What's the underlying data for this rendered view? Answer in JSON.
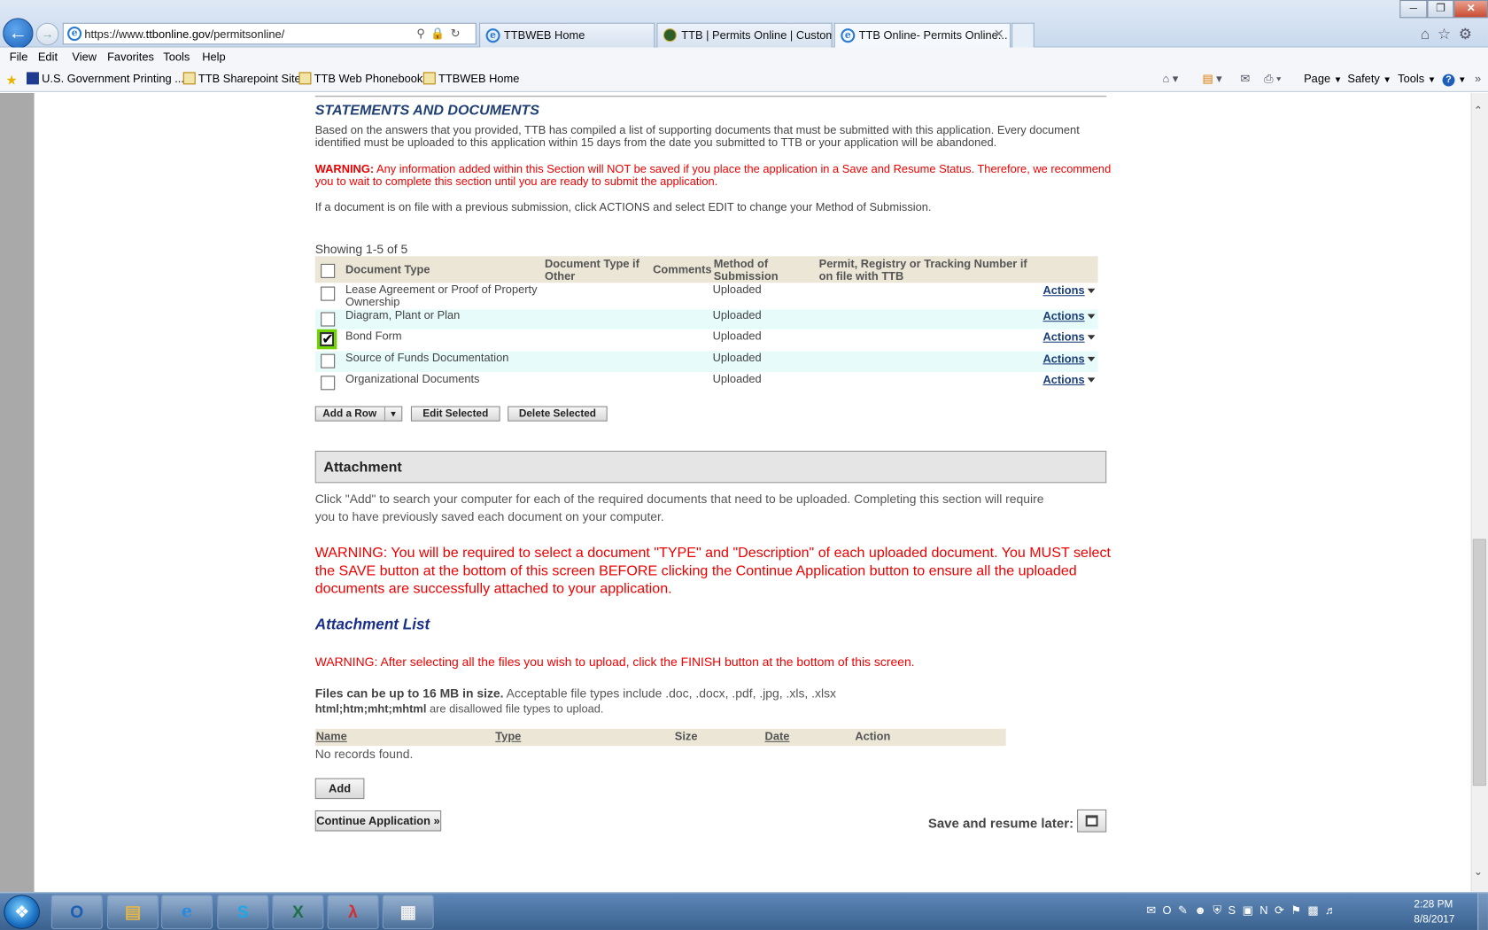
{
  "browser": {
    "address": "https://www.ttbonline.gov/permitsonline/",
    "address_prefix": "https://www.",
    "address_host": "ttbonline.gov",
    "address_path": "/permitsonline/",
    "tabs": [
      {
        "label": "TTBWEB Home"
      },
      {
        "label": "TTB | Permits Online | Custom..."
      },
      {
        "label": "TTB Online- Permits Online..."
      }
    ],
    "menu": [
      "File",
      "Edit",
      "View",
      "Favorites",
      "Tools",
      "Help"
    ],
    "favorites": [
      "U.S. Government Printing ...",
      "TTB Sharepoint Site",
      "TTB Web Phonebook",
      "TTBWEB Home"
    ],
    "commands": [
      "Page",
      "Safety",
      "Tools"
    ]
  },
  "statements": {
    "title": "STATEMENTS AND DOCUMENTS",
    "intro_line1": "Based on the answers that you provided, TTB has compiled a list of supporting documents that must be submitted with this application. Every document",
    "intro_line2": "identified must be uploaded to this application within 15 days from the date you submitted to TTB or your application will be abandoned.",
    "warning_label": "WARNING:",
    "warning_line1": " Any information added within this Section will NOT be saved if you place the application in a Save and Resume Status. Therefore, we recommend",
    "warning_line2": "you to wait to complete this section until you are ready to submit the application.",
    "onfile_note": "If a document is on file with a previous submission, click ACTIONS and select EDIT to change your Method of Submission.",
    "showing": "Showing 1-5 of 5",
    "columns": {
      "doc_type": "Document Type",
      "doc_type_other_1": "Document Type if",
      "doc_type_other_2": "Other",
      "comments": "Comments",
      "method_1": "Method of",
      "method_2": "Submission",
      "permit_1": "Permit, Registry or Tracking Number if",
      "permit_2": "on file with TTB"
    },
    "rows": [
      {
        "type_1": "Lease Agreement or Proof of Property",
        "type_2": "Ownership",
        "method": "Uploaded",
        "checked": false,
        "action": "Actions"
      },
      {
        "type_1": "Diagram, Plant or Plan",
        "type_2": "",
        "method": "Uploaded",
        "checked": false,
        "action": "Actions"
      },
      {
        "type_1": "Bond Form",
        "type_2": "",
        "method": "Uploaded",
        "checked": true,
        "action": "Actions"
      },
      {
        "type_1": "Source of Funds Documentation",
        "type_2": "",
        "method": "Uploaded",
        "checked": false,
        "action": "Actions"
      },
      {
        "type_1": "Organizational Documents",
        "type_2": "",
        "method": "Uploaded",
        "checked": false,
        "action": "Actions"
      }
    ],
    "buttons": {
      "add_row": "Add a Row",
      "edit_selected": "Edit Selected",
      "delete_selected": "Delete Selected"
    }
  },
  "attachment": {
    "title": "Attachment",
    "instr_line1": "Click \"Add\" to search your computer for each of the required documents that need to be uploaded.  Completing this section will require",
    "instr_line2": "you to have previously saved each document on your computer.",
    "warn_line1": "WARNING: You will be required to select a document \"TYPE\" and \"Description\" of each uploaded document. You MUST select",
    "warn_line2": "the SAVE button at the bottom of this screen BEFORE clicking the Continue Application button to ensure all the uploaded",
    "warn_line3": "documents are successfully attached to your application.",
    "list_title": "Attachment List",
    "finish_warning": "WARNING: After selecting all the files you wish to upload, click the FINISH button at the bottom of this screen.",
    "size_bold": "Files can be up to 16 MB in size.",
    "size_rest": " Acceptable file types include .doc, .docx, .pdf, .jpg, .xls, .xlsx",
    "disallowed_bold": "html;htm;mht;mhtml",
    "disallowed_rest": " are disallowed file types to upload.",
    "columns": {
      "name": "Name",
      "type": "Type",
      "size": "Size",
      "date": "Date",
      "action": "Action"
    },
    "empty": "No records found.",
    "add_button": "Add",
    "continue_button": "Continue Application »",
    "save_later": "Save and resume later:"
  },
  "taskbar": {
    "time": "2:28 PM",
    "date": "8/8/2017"
  }
}
